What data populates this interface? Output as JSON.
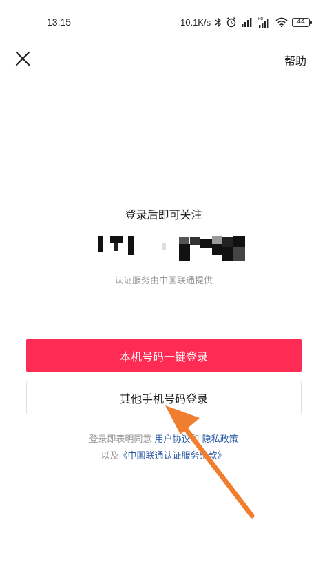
{
  "status_bar": {
    "time": "13:15",
    "net_speed": "10.1K/s",
    "battery": "44",
    "icons": [
      "bluetooth-icon",
      "alarm-icon",
      "signal-icon",
      "signal-hd-icon",
      "wifi-icon",
      "battery-icon"
    ]
  },
  "header": {
    "close_icon": "close-icon",
    "help_label": "帮助"
  },
  "main": {
    "title": "登录后即可关注",
    "provider_note": "认证服务由中国联通提供",
    "primary_button": "本机号码一键登录",
    "secondary_button": "其他手机号码登录"
  },
  "terms": {
    "prefix": "登录即表明同意",
    "user_agreement": "用户协议",
    "and": "和",
    "privacy_policy": "隐私政策",
    "also": "以及",
    "unicom_terms": "《中国联通认证服务条款》"
  },
  "colors": {
    "primary": "#fe2c55",
    "link": "#2a5aa6",
    "arrow": "#f07e2e"
  }
}
